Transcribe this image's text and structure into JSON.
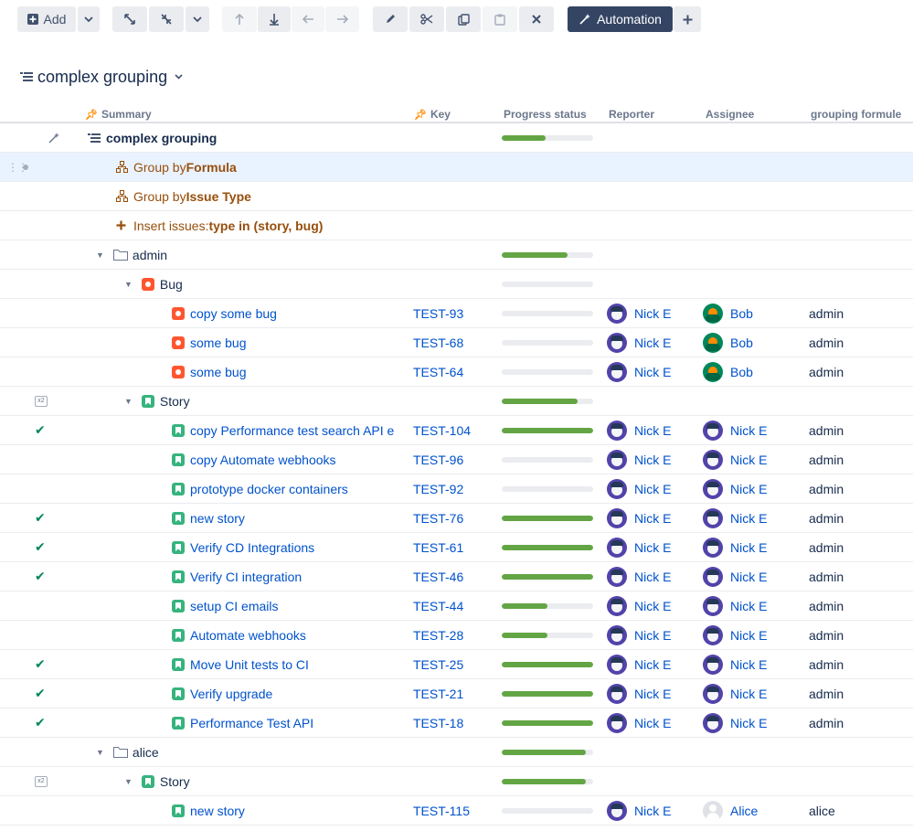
{
  "toolbar": {
    "add_label": "Add",
    "automation_label": "Automation"
  },
  "structure": {
    "title": "complex grouping"
  },
  "columns": {
    "summary": "Summary",
    "key": "Key",
    "progress": "Progress status",
    "reporter": "Reporter",
    "assignee": "Assignee",
    "grouping": "grouping formule"
  },
  "rows": {
    "root": {
      "label": "complex grouping",
      "progress": 0.48
    },
    "gen_formula": {
      "prefix": "Group by ",
      "value": "Formula"
    },
    "gen_type": {
      "prefix": "Group by ",
      "value": "Issue Type"
    },
    "gen_insert": {
      "prefix": "Insert issues: ",
      "value": "type in (story, bug)"
    },
    "admin": {
      "label": "admin",
      "progress": 0.72
    },
    "admin_bug": {
      "label": "Bug",
      "progress": 0.0
    },
    "admin_story": {
      "label": "Story",
      "progress": 0.83
    },
    "alice": {
      "label": "alice",
      "progress": 0.92
    },
    "alice_story": {
      "label": "Story",
      "progress": 0.92
    }
  },
  "bug_issues": [
    {
      "summary": "copy some bug",
      "key": "TEST-93",
      "progress": 0.0,
      "reporter": "Nick E",
      "assignee": "Bob",
      "grouping": "admin"
    },
    {
      "summary": "some bug",
      "key": "TEST-68",
      "progress": 0.0,
      "reporter": "Nick E",
      "assignee": "Bob",
      "grouping": "admin"
    },
    {
      "summary": "some bug",
      "key": "TEST-64",
      "progress": 0.0,
      "reporter": "Nick E",
      "assignee": "Bob",
      "grouping": "admin"
    }
  ],
  "story_issues": [
    {
      "summary": "copy Performance test search API e",
      "key": "TEST-104",
      "progress": 1.0,
      "done": true,
      "reporter": "Nick E",
      "assignee": "Nick E",
      "grouping": "admin"
    },
    {
      "summary": "copy Automate webhooks",
      "key": "TEST-96",
      "progress": 0.0,
      "done": false,
      "reporter": "Nick E",
      "assignee": "Nick E",
      "grouping": "admin"
    },
    {
      "summary": "prototype docker containers",
      "key": "TEST-92",
      "progress": 0.0,
      "done": false,
      "reporter": "Nick E",
      "assignee": "Nick E",
      "grouping": "admin"
    },
    {
      "summary": "new story",
      "key": "TEST-76",
      "progress": 1.0,
      "done": true,
      "reporter": "Nick E",
      "assignee": "Nick E",
      "grouping": "admin"
    },
    {
      "summary": "Verify CD Integrations",
      "key": "TEST-61",
      "progress": 1.0,
      "done": true,
      "reporter": "Nick E",
      "assignee": "Nick E",
      "grouping": "admin"
    },
    {
      "summary": "Verify CI integration",
      "key": "TEST-46",
      "progress": 1.0,
      "done": true,
      "reporter": "Nick E",
      "assignee": "Nick E",
      "grouping": "admin"
    },
    {
      "summary": "setup CI emails",
      "key": "TEST-44",
      "progress": 0.5,
      "done": false,
      "reporter": "Nick E",
      "assignee": "Nick E",
      "grouping": "admin"
    },
    {
      "summary": "Automate webhooks",
      "key": "TEST-28",
      "progress": 0.5,
      "done": false,
      "reporter": "Nick E",
      "assignee": "Nick E",
      "grouping": "admin"
    },
    {
      "summary": "Move Unit tests to CI",
      "key": "TEST-25",
      "progress": 1.0,
      "done": true,
      "reporter": "Nick E",
      "assignee": "Nick E",
      "grouping": "admin"
    },
    {
      "summary": "Verify upgrade",
      "key": "TEST-21",
      "progress": 1.0,
      "done": true,
      "reporter": "Nick E",
      "assignee": "Nick E",
      "grouping": "admin"
    },
    {
      "summary": "Performance Test API",
      "key": "TEST-18",
      "progress": 1.0,
      "done": true,
      "reporter": "Nick E",
      "assignee": "Nick E",
      "grouping": "admin"
    }
  ],
  "alice_issues": [
    {
      "summary": "new story",
      "key": "TEST-115",
      "progress": 0.0,
      "reporter": "Nick E",
      "assignee": "Alice",
      "grouping": "alice"
    }
  ]
}
